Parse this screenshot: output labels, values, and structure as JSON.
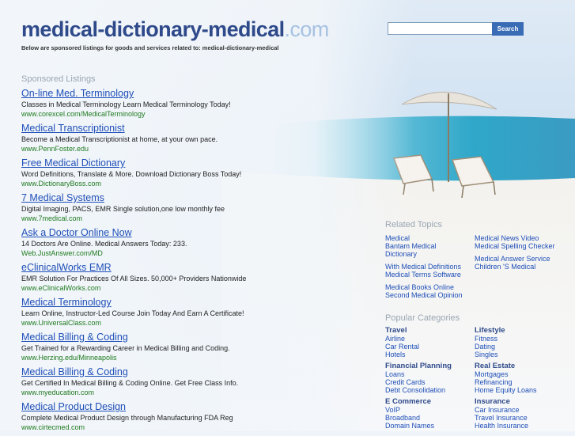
{
  "header": {
    "site_name": "medical-dictionary-medical",
    "tld": ".com",
    "subline": "Below are sponsored listings for goods and services related to: medical-dictionary-medical"
  },
  "search": {
    "placeholder": "",
    "button_label": "Search"
  },
  "sponsored": {
    "heading": "Sponsored Listings",
    "listings": [
      {
        "title": "On-line Med. Terminology",
        "desc": "Classes in Medical Terminology Learn Medical Terminology Today!",
        "url": "www.corexcel.com/MedicalTerminology"
      },
      {
        "title": "Medical Transcriptionist",
        "desc": "Become a Medical Transcriptionist at home, at your own pace.",
        "url": "www.PennFoster.edu"
      },
      {
        "title": "Free Medical Dictionary",
        "desc": "Word Definitions, Translate & More. Download Dictionary Boss Today!",
        "url": "www.DictionaryBoss.com"
      },
      {
        "title": "7 Medical Systems",
        "desc": "Digital Imaging, PACS, EMR Single solution,one low monthly fee",
        "url": "www.7medical.com"
      },
      {
        "title": "Ask a Doctor Online Now",
        "desc": "14 Doctors Are Online. Medical Answers Today: 233.",
        "url": "Web.JustAnswer.com/MD"
      },
      {
        "title": "eClinicalWorks EMR",
        "desc": "EMR Solution For Practices Of All Sizes. 50,000+ Providers Nationwide",
        "url": "www.eClinicalWorks.com"
      },
      {
        "title": "Medical Terminology",
        "desc": "Learn Online, Instructor-Led Course Join Today And Earn A Certificate!",
        "url": "www.UniversalClass.com"
      },
      {
        "title": "Medical Billing & Coding",
        "desc": "Get Trained for a Rewarding Career in Medical Billing and Coding.",
        "url": "www.Herzing.edu/Minneapolis"
      },
      {
        "title": "Medical Billing & Coding",
        "desc": "Get Certified In Medical Billing & Coding Online. Get Free Class Info.",
        "url": "www.myeducation.com"
      },
      {
        "title": "Medical Product Design",
        "desc": "Complete Medical Product Design through Manufacturing FDA Reg",
        "url": "www.cirtecmed.com"
      }
    ]
  },
  "related": {
    "heading": "Related Topics",
    "left": [
      [
        "Medical",
        "Bantam Medical",
        "Dictionary"
      ],
      [
        "With Medical Definitions",
        "Medical Terms Software"
      ],
      [
        "Medical Books Online",
        "Second Medical Opinion"
      ]
    ],
    "right": [
      [
        "Medical News Video",
        "Medical Spelling Checker"
      ],
      [
        "Medical Answer Service",
        "Children 'S Medical"
      ]
    ]
  },
  "popular": {
    "heading": "Popular Categories",
    "categories": [
      {
        "name": "Travel",
        "items": [
          "Airline",
          "Car Rental",
          "Hotels"
        ]
      },
      {
        "name": "Lifestyle",
        "items": [
          "Fitness",
          "Dating",
          "Singles"
        ]
      },
      {
        "name": "Financial Planning",
        "items": [
          "Loans",
          "Credit Cards",
          "Debt Consolidation"
        ]
      },
      {
        "name": "Real Estate",
        "items": [
          "Mortgages",
          "Refinancing",
          "Home Equity Loans"
        ]
      },
      {
        "name": "E Commerce",
        "items": [
          "VoIP",
          "Broadband",
          "Domain Names"
        ]
      },
      {
        "name": "Insurance",
        "items": [
          "Car Insurance",
          "Travel Insurance",
          "Health Insurance"
        ]
      }
    ]
  },
  "colors": {
    "title": "#2f4a8a",
    "link": "#1f4fb8",
    "url": "#1f7a1f",
    "button": "#3a6cb5",
    "muted": "#9aa6b2"
  }
}
